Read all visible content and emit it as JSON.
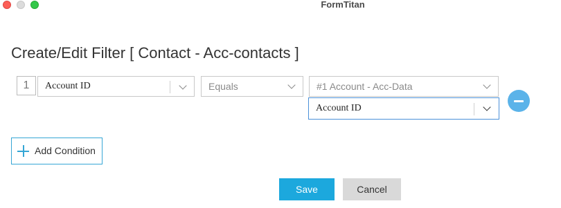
{
  "window": {
    "title": "FormTitan"
  },
  "dialog": {
    "heading": "Create/Edit Filter [ Contact - Acc-contacts ]"
  },
  "condition": {
    "index": "1",
    "field": "Account ID",
    "operator": "Equals",
    "source": "#1 Account - Acc-Data",
    "value": "Account ID"
  },
  "actions": {
    "add_condition": "Add Condition",
    "save": "Save",
    "cancel": "Cancel"
  },
  "colors": {
    "accent": "#1ca8dd",
    "remove_button": "#5bb3e9",
    "cancel_button": "#d9d9d9",
    "focus_border": "#4a90d9"
  },
  "icons": [
    "close-icon",
    "minimize-icon",
    "maximize-icon",
    "chevron-down-icon",
    "minus-icon",
    "plus-icon"
  ]
}
